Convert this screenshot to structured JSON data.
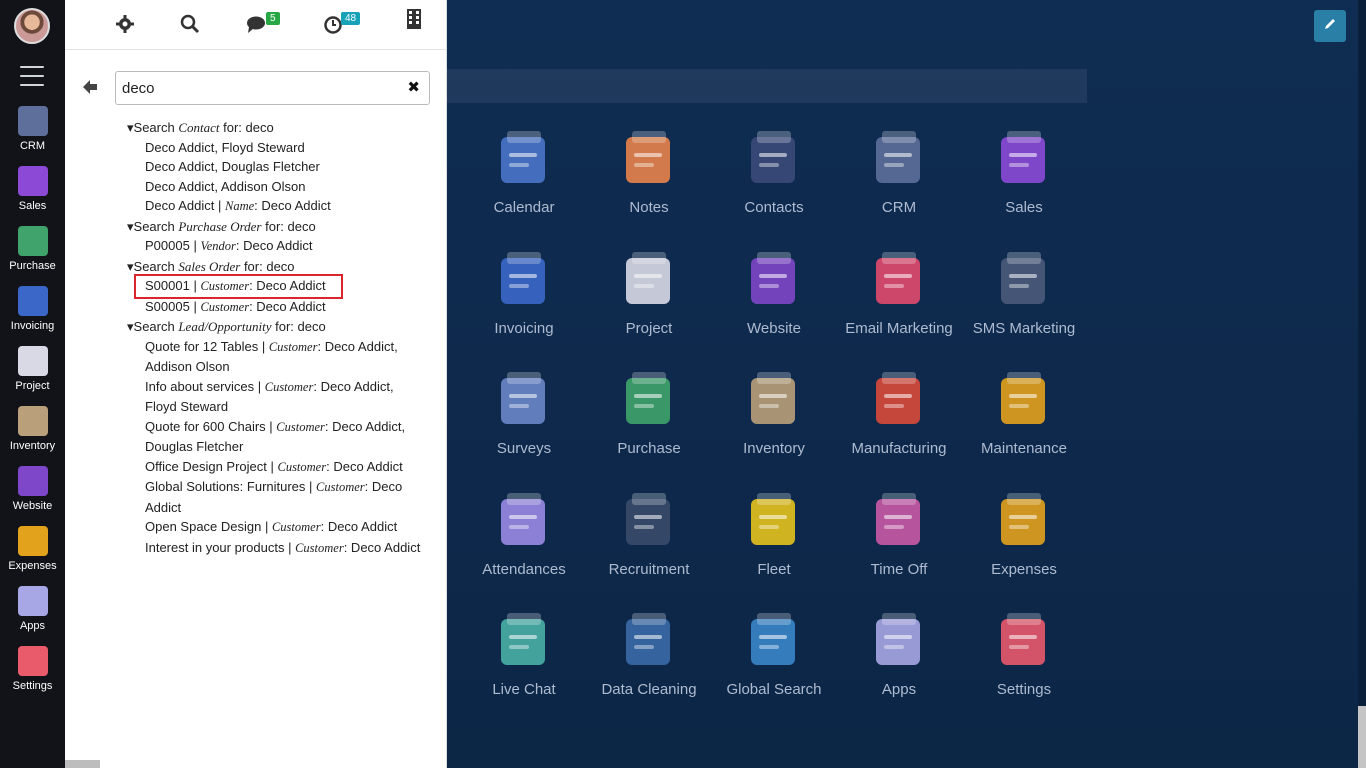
{
  "sidebar": {
    "apps": [
      {
        "label": "CRM",
        "color": "#5d6f9a"
      },
      {
        "label": "Sales",
        "color": "#8b49d6"
      },
      {
        "label": "Purchase",
        "color": "#3fa36b"
      },
      {
        "label": "Invoicing",
        "color": "#3b67c9"
      },
      {
        "label": "Project",
        "color": "#d9d9e6"
      },
      {
        "label": "Inventory",
        "color": "#b9a07a"
      },
      {
        "label": "Website",
        "color": "#7e46c9"
      },
      {
        "label": "Expenses",
        "color": "#e3a21c"
      },
      {
        "label": "Apps",
        "color": "#a7a7e6"
      },
      {
        "label": "Settings",
        "color": "#e95a6b"
      }
    ]
  },
  "topbar": {
    "messages_count": "5",
    "activities_count": "48"
  },
  "search": {
    "value": "deco",
    "clear_symbol": "✖",
    "back_symbol": "🡐"
  },
  "results": {
    "contact": {
      "prefix": "▾Search ",
      "model": "Contact",
      "suffix": " for: deco",
      "items": [
        "Deco Addict, Floyd Steward",
        "Deco Addict, Douglas Fletcher",
        "Deco Addict, Addison Olson"
      ],
      "last_item": {
        "name": "Deco Addict",
        "sep": " | ",
        "field": "Name",
        "value": ": Deco Addict"
      }
    },
    "purchase": {
      "prefix": "▾Search ",
      "model": "Purchase Order",
      "suffix": " for: deco",
      "items": [
        {
          "name": "P00005",
          "sep": " | ",
          "field": "Vendor",
          "value": ": Deco Addict"
        }
      ]
    },
    "sales": {
      "prefix": "▾Search ",
      "model": "Sales Order",
      "suffix": " for: deco",
      "items": [
        {
          "name": "S00001",
          "sep": " | ",
          "field": "Customer",
          "value": ": Deco Addict"
        },
        {
          "name": "S00005",
          "sep": " | ",
          "field": "Customer",
          "value": ": Deco Addict"
        }
      ]
    },
    "lead": {
      "prefix": "▾Search ",
      "model": "Lead/Opportunity",
      "suffix": " for: deco",
      "items": [
        {
          "name": "Quote for 12 Tables",
          "sep": " | ",
          "field": "Customer",
          "value": ": Deco Addict, Addison Olson"
        },
        {
          "name": "Info about services",
          "sep": " | ",
          "field": "Customer",
          "value": ": Deco Addict, Floyd Steward"
        },
        {
          "name": "Quote for 600 Chairs",
          "sep": " | ",
          "field": "Customer",
          "value": ": Deco Addict, Douglas Fletcher"
        },
        {
          "name": "Office Design Project",
          "sep": " | ",
          "field": "Customer",
          "value": ": Deco Addict"
        },
        {
          "name": "Global Solutions: Furnitures",
          "sep": " | ",
          "field": "Customer",
          "value": ": Deco Addict"
        },
        {
          "name": "Open Space Design",
          "sep": " | ",
          "field": "Customer",
          "value": ": Deco Addict"
        },
        {
          "name": "Interest in your products",
          "sep": " | ",
          "field": "Customer",
          "value": ": Deco Addict"
        }
      ]
    }
  },
  "main_apps": [
    {
      "label": "Calendar",
      "color": "#4a74c9"
    },
    {
      "label": "Notes",
      "color": "#e8834a"
    },
    {
      "label": "Contacts",
      "color": "#3b4a7a"
    },
    {
      "label": "CRM",
      "color": "#5d6f9a"
    },
    {
      "label": "Sales",
      "color": "#8b49d6"
    },
    {
      "label": "Invoicing",
      "color": "#3b67c9"
    },
    {
      "label": "Project",
      "color": "#d9d9e6"
    },
    {
      "label": "Website",
      "color": "#7e46c9"
    },
    {
      "label": "Email Marketing",
      "color": "#e24a6e"
    },
    {
      "label": "SMS Marketing",
      "color": "#4a5a7a"
    },
    {
      "label": "Surveys",
      "color": "#6a86c9"
    },
    {
      "label": "Purchase",
      "color": "#3fa36b"
    },
    {
      "label": "Inventory",
      "color": "#b9a07a"
    },
    {
      "label": "Manufacturing",
      "color": "#d94a3a"
    },
    {
      "label": "Maintenance",
      "color": "#e3a21c"
    },
    {
      "label": "Attendances",
      "color": "#9a8ae6"
    },
    {
      "label": "Recruitment",
      "color": "#3a4a6a"
    },
    {
      "label": "Fleet",
      "color": "#e6c21c"
    },
    {
      "label": "Time Off",
      "color": "#c95aa6"
    },
    {
      "label": "Expenses",
      "color": "#e3a21c"
    },
    {
      "label": "Live Chat",
      "color": "#4ab0a6"
    },
    {
      "label": "Data Cleaning",
      "color": "#3a6aa6"
    },
    {
      "label": "Global Search",
      "color": "#3a86c9"
    },
    {
      "label": "Apps",
      "color": "#a7a7e6"
    },
    {
      "label": "Settings",
      "color": "#e95a6b"
    }
  ]
}
